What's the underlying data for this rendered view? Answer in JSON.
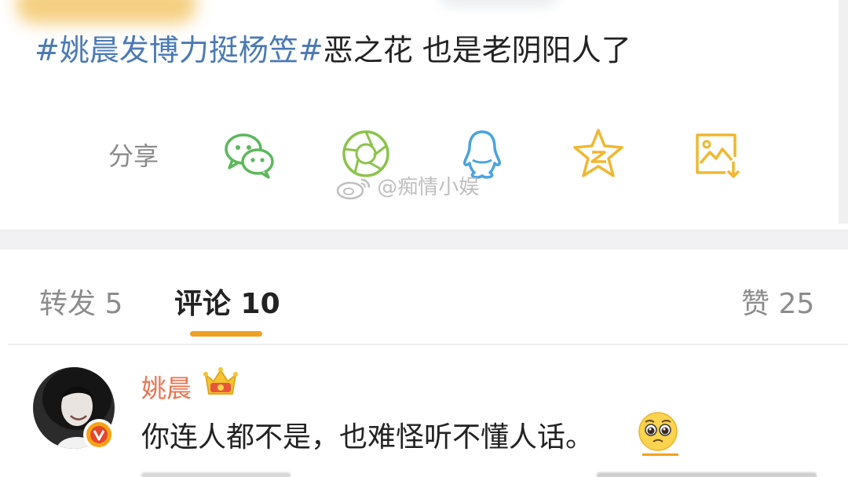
{
  "post": {
    "hashtag": "#姚晨发博力挺杨笠#",
    "text": "恶之花 也是老阴阳人了"
  },
  "share": {
    "label": "分享",
    "icons": [
      "wechat-icon",
      "moments-icon",
      "qq-icon",
      "qzone-icon",
      "save-image-icon"
    ],
    "colors": {
      "green": "#5cb85c",
      "lime": "#8bc34a",
      "blue": "#4aa3df",
      "gold": "#f0b830"
    }
  },
  "watermark": {
    "text": "@痴情小娱"
  },
  "tabs": [
    {
      "label": "转发 5"
    },
    {
      "label": "评论 10"
    },
    {
      "label": "赞 25"
    }
  ],
  "comment": {
    "author": "姚晨",
    "text": "你连人都不是，也难怪听不懂人话。",
    "accent": "#eb7350"
  }
}
